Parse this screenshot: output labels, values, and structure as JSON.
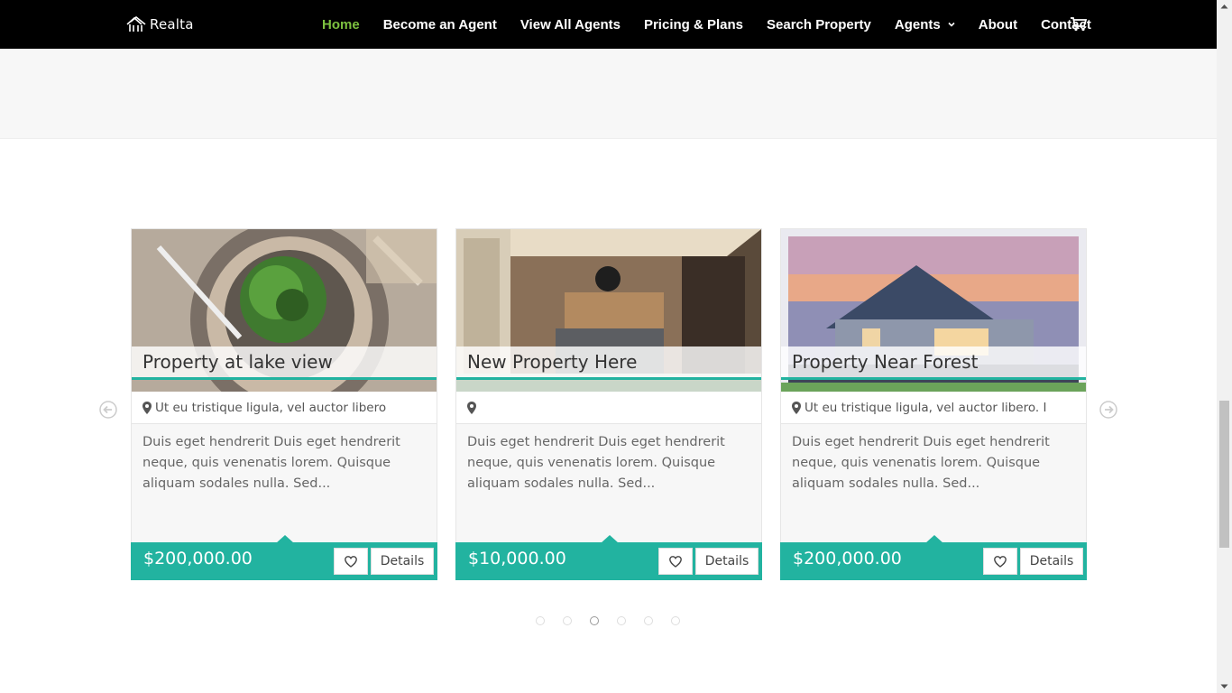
{
  "header": {
    "logo_text": "Realta",
    "nav": [
      {
        "label": "Home",
        "active": true
      },
      {
        "label": "Become an Agent"
      },
      {
        "label": "View All Agents"
      },
      {
        "label": "Pricing & Plans"
      },
      {
        "label": "Search Property"
      },
      {
        "label": "Agents",
        "has_dropdown": true
      },
      {
        "label": "About"
      },
      {
        "label": "Contact"
      }
    ],
    "cart_icon": "cart-icon",
    "active_color": "#7cc13f"
  },
  "carousel": {
    "accent_color": "#22b3a0",
    "cards": [
      {
        "title": "Property at lake view",
        "location": "Ut eu tristique ligula, vel auctor libero",
        "description": "Duis eget hendrerit Duis eget hendrerit neque, quis venenatis lorem. Quisque aliquam sodales nulla. Sed...",
        "price": "$200,000.00",
        "details_label": "Details"
      },
      {
        "title": "New Property Here",
        "location": "",
        "description": "Duis eget hendrerit Duis eget hendrerit neque, quis venenatis lorem. Quisque aliquam sodales nulla. Sed...",
        "price": "$10,000.00",
        "details_label": "Details"
      },
      {
        "title": "Property Near Forest",
        "location": "Ut eu tristique ligula, vel auctor libero. I",
        "description": "Duis eget hendrerit Duis eget hendrerit neque, quis venenatis lorem. Quisque aliquam sodales nulla. Sed...",
        "price": "$200,000.00",
        "details_label": "Details"
      }
    ],
    "pagination": {
      "count": 6,
      "active_index": 2
    }
  }
}
